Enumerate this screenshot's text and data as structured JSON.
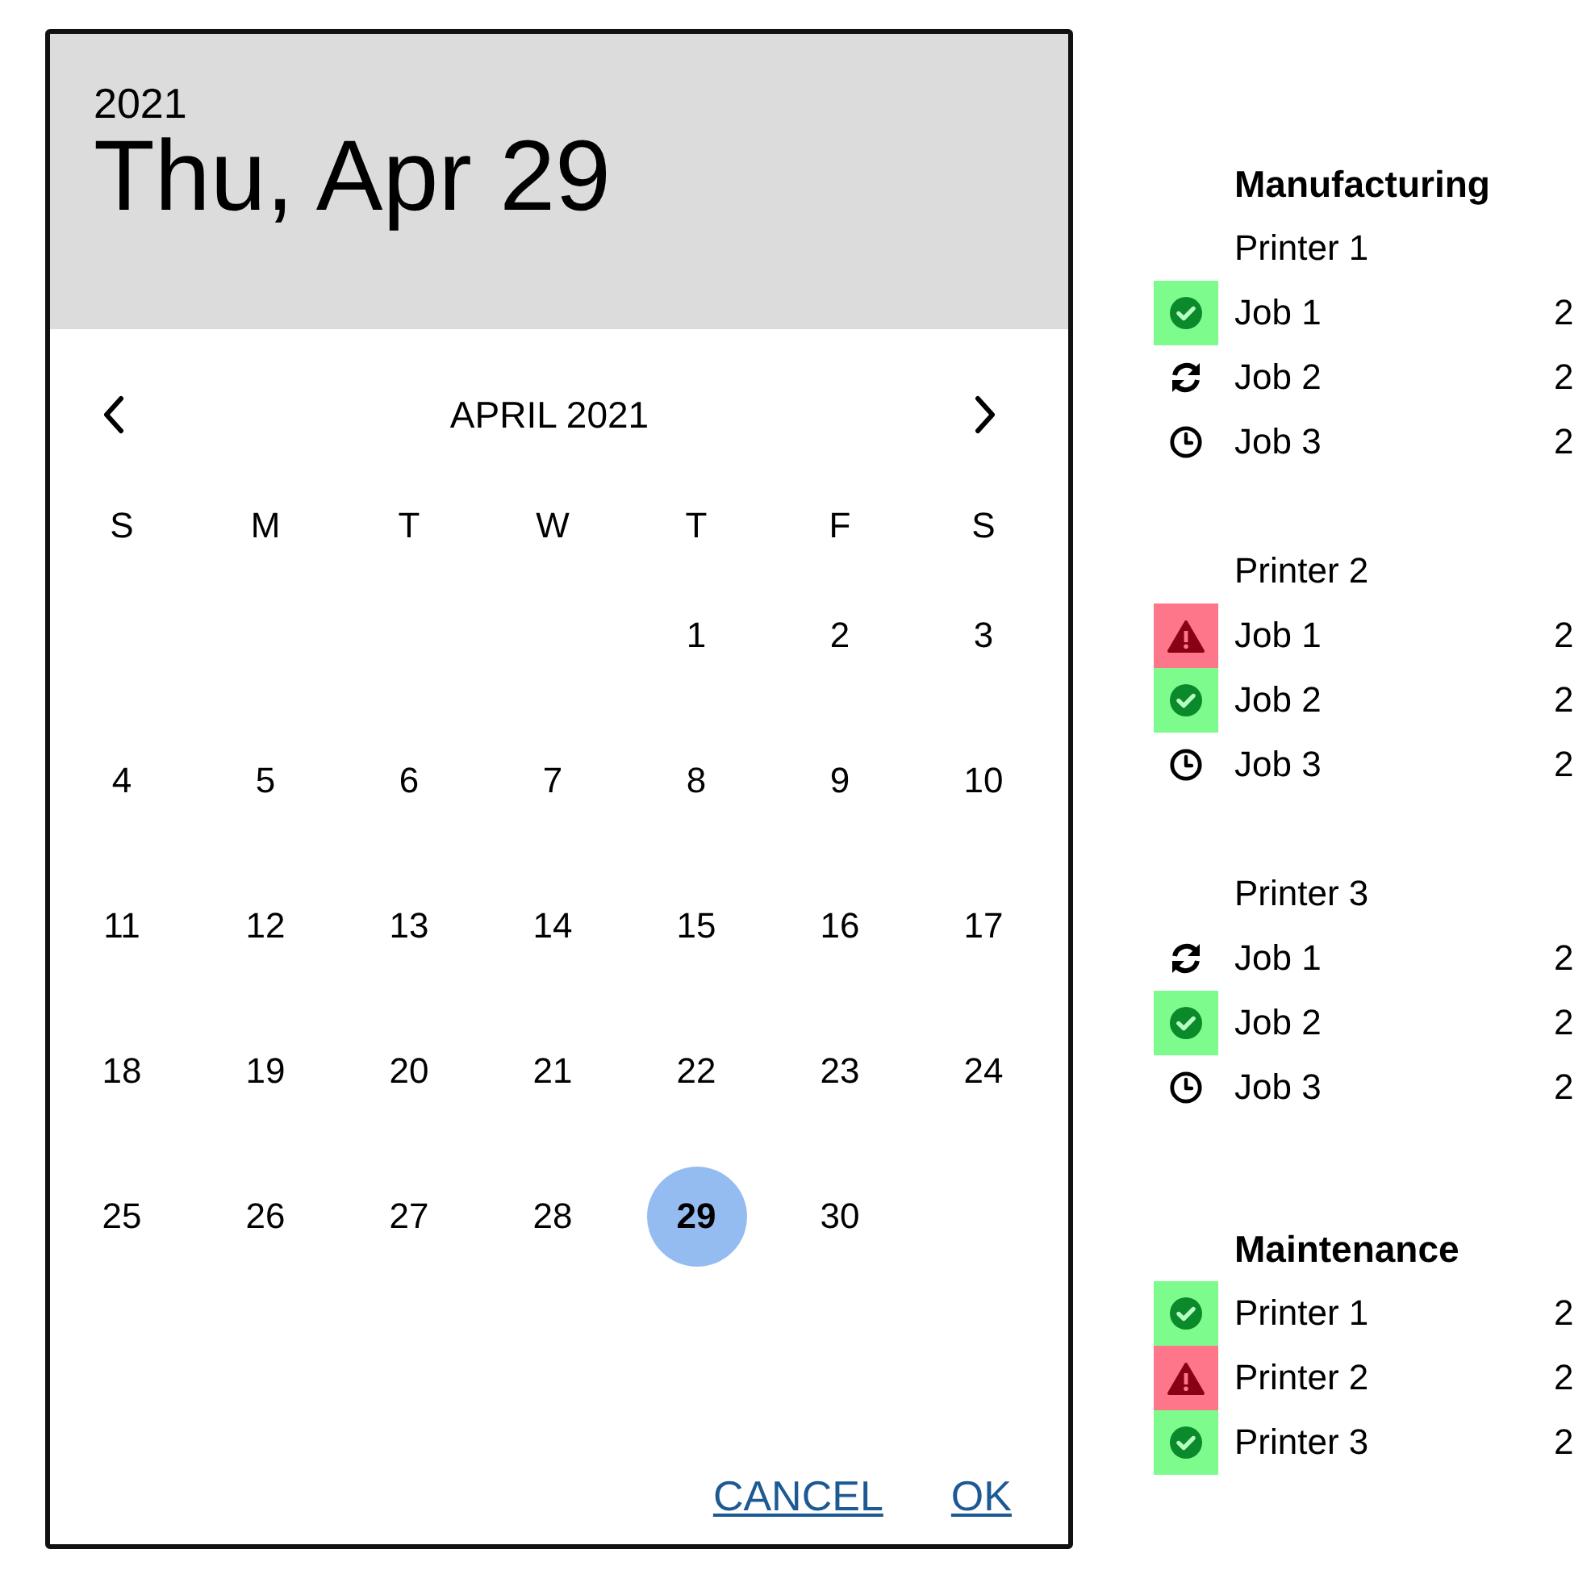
{
  "dialog": {
    "header": {
      "year": "2021",
      "date": "Thu, Apr 29"
    },
    "month_label": "APRIL 2021",
    "weekdays": [
      "S",
      "M",
      "T",
      "W",
      "T",
      "F",
      "S"
    ],
    "weeks": [
      {
        "kind": "leading",
        "days": [
          {
            "label": "1",
            "selected": false
          },
          {
            "label": "2",
            "selected": false
          },
          {
            "label": "3",
            "selected": false
          }
        ]
      },
      {
        "kind": "full",
        "days": [
          {
            "label": "4",
            "selected": false
          },
          {
            "label": "5",
            "selected": false
          },
          {
            "label": "6",
            "selected": false
          },
          {
            "label": "7",
            "selected": false
          },
          {
            "label": "8",
            "selected": false
          },
          {
            "label": "9",
            "selected": false
          },
          {
            "label": "10",
            "selected": false
          }
        ]
      },
      {
        "kind": "full",
        "days": [
          {
            "label": "11",
            "selected": false
          },
          {
            "label": "12",
            "selected": false
          },
          {
            "label": "13",
            "selected": false
          },
          {
            "label": "14",
            "selected": false
          },
          {
            "label": "15",
            "selected": false
          },
          {
            "label": "16",
            "selected": false
          },
          {
            "label": "17",
            "selected": false
          }
        ]
      },
      {
        "kind": "full",
        "days": [
          {
            "label": "18",
            "selected": false
          },
          {
            "label": "19",
            "selected": false
          },
          {
            "label": "20",
            "selected": false
          },
          {
            "label": "21",
            "selected": false
          },
          {
            "label": "22",
            "selected": false
          },
          {
            "label": "23",
            "selected": false
          },
          {
            "label": "24",
            "selected": false
          }
        ]
      },
      {
        "kind": "trailing",
        "days": [
          {
            "label": "25",
            "selected": false
          },
          {
            "label": "26",
            "selected": false
          },
          {
            "label": "27",
            "selected": false
          },
          {
            "label": "28",
            "selected": false
          },
          {
            "label": "29",
            "selected": true
          },
          {
            "label": "30",
            "selected": false
          }
        ]
      }
    ],
    "buttons": [
      "CANCEL",
      "OK"
    ]
  },
  "status_list": {
    "sections": [
      {
        "title": "Manufacturing",
        "printers": [
          {
            "name": "Printer 1",
            "jobs": [
              {
                "name": "Job 1",
                "kind": "done",
                "column_3": "2"
              },
              {
                "name": "Job 2",
                "kind": "running",
                "column_3": "2"
              },
              {
                "name": "Job 3",
                "kind": "pending",
                "column_3": "2"
              }
            ]
          },
          {
            "name": "Printer 2",
            "jobs": [
              {
                "name": "Job 1",
                "kind": "error",
                "column_3": "2"
              },
              {
                "name": "Job 2",
                "kind": "done",
                "column_3": "2"
              },
              {
                "name": "Job 3",
                "kind": "pending",
                "column_3": "2"
              }
            ]
          },
          {
            "name": "Printer 3",
            "jobs": [
              {
                "name": "Job 1",
                "kind": "running",
                "column_3": "2"
              },
              {
                "name": "Job 2",
                "kind": "done",
                "column_3": "2"
              },
              {
                "name": "Job 3",
                "kind": "pending",
                "column_3": "2"
              }
            ]
          }
        ]
      },
      {
        "title": "Maintenance",
        "printers": [
          {
            "name": "Printer 1",
            "kind": "done",
            "column_3": "2"
          },
          {
            "name": "Printer 2",
            "kind": "error",
            "column_3": "2"
          },
          {
            "name": "Printer 3",
            "kind": "done",
            "column_3": "2"
          }
        ]
      }
    ]
  }
}
